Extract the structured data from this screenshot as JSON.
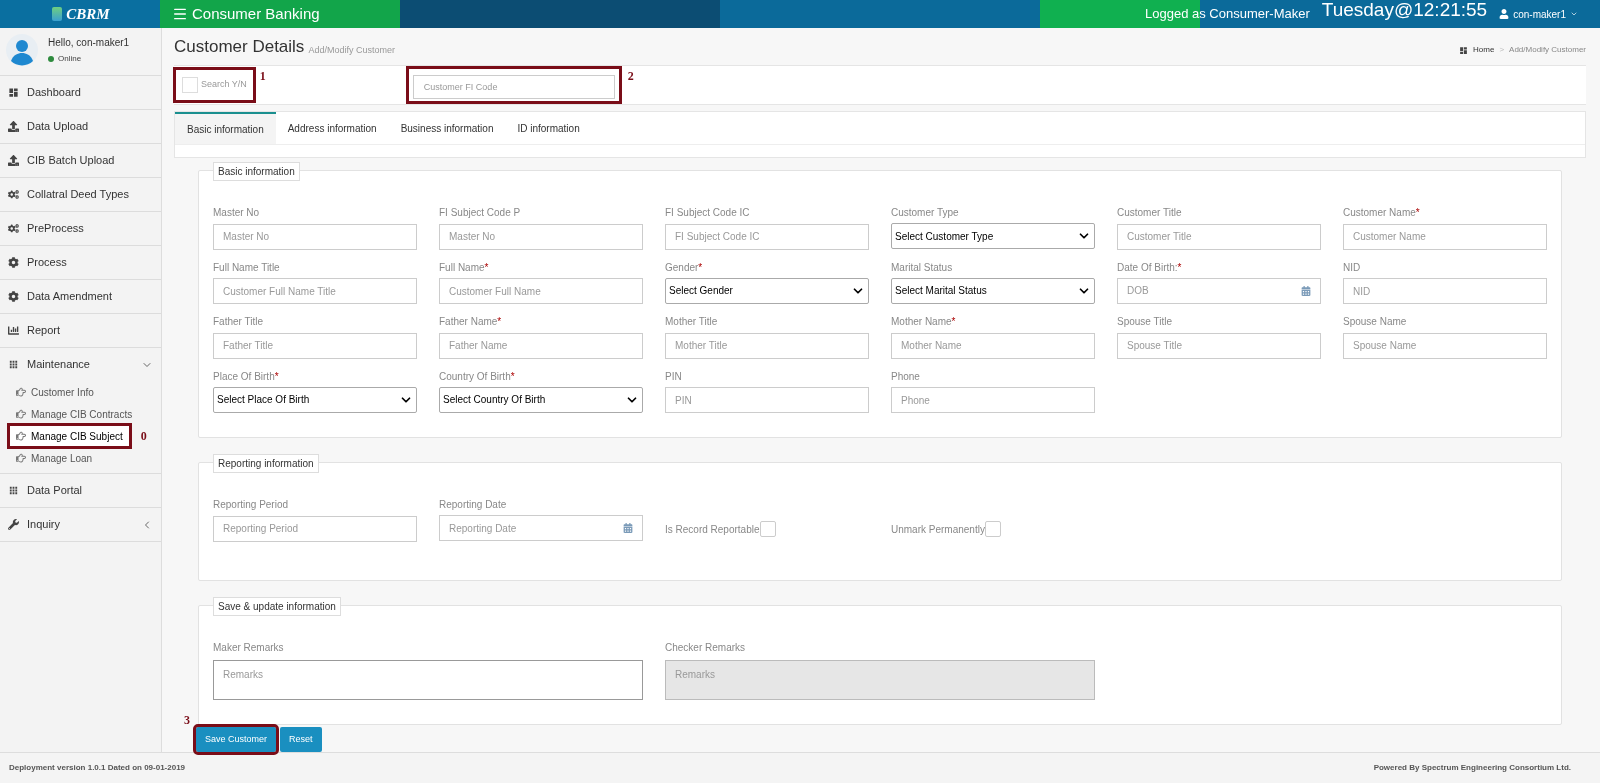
{
  "header": {
    "logo": "CBRM",
    "app_title": "Consumer Banking",
    "logged_as": "Logged as Consumer-Maker",
    "clock": "Tuesday@12:21:55",
    "user": "con-maker1"
  },
  "user_panel": {
    "greeting": "Hello, con-maker1",
    "status": "Online"
  },
  "sidebar": {
    "items": [
      {
        "label": "Dashboard",
        "kind": "dashboard",
        "selected": false
      },
      {
        "label": "Data Upload",
        "kind": "upload",
        "selected": false
      },
      {
        "label": "CIB Batch Upload",
        "kind": "upload",
        "selected": false
      },
      {
        "label": "Collatral Deed Types",
        "kind": "cogs",
        "selected": false
      },
      {
        "label": "PreProcess",
        "kind": "cogs",
        "selected": false
      },
      {
        "label": "Process",
        "kind": "cog",
        "selected": false
      },
      {
        "label": "Data Amendment",
        "kind": "cog",
        "selected": false
      },
      {
        "label": "Report",
        "kind": "chart",
        "selected": false
      },
      {
        "label": "Maintenance",
        "kind": "grid",
        "selected": false,
        "expanded": true,
        "children": [
          {
            "label": "Customer Info",
            "selected": false
          },
          {
            "label": "Manage CIB Contracts",
            "selected": false
          },
          {
            "label": "Manage CIB Subject",
            "selected": true,
            "annotation": "0"
          },
          {
            "label": "Manage Loan",
            "selected": false
          }
        ]
      },
      {
        "label": "Data Portal",
        "kind": "grid",
        "selected": false
      },
      {
        "label": "Inquiry",
        "kind": "wrench",
        "selected": false,
        "expanded": false
      }
    ]
  },
  "page": {
    "title": "Customer Details",
    "subtitle": "Add/Modify Customer",
    "breadcrumb": [
      "Home",
      "Add/Modify Customer"
    ],
    "breadcrumb_separator": ">"
  },
  "search": {
    "checkbox_label": "Search Y/N",
    "checked": false,
    "checkbox_annotation": "1",
    "placeholder": "Customer FI Code",
    "field_annotation": "2"
  },
  "tabs": [
    {
      "label": "Basic information",
      "selected": true
    },
    {
      "label": "Address information",
      "selected": false
    },
    {
      "label": "Business information",
      "selected": false
    },
    {
      "label": "ID information",
      "selected": false
    }
  ],
  "basic_section": {
    "legend": "Basic information",
    "fields": [
      {
        "label": "Master No",
        "kind": "input",
        "placeholder": "Master No"
      },
      {
        "label": "FI Subject Code P",
        "kind": "input",
        "placeholder": "Master No"
      },
      {
        "label": "FI Subject Code IC",
        "kind": "input",
        "placeholder": "FI Subject Code IC"
      },
      {
        "label": "Customer Type",
        "kind": "select",
        "value": "Select Customer Type"
      },
      {
        "label": "Customer Title",
        "kind": "input",
        "placeholder": "Customer Title"
      },
      {
        "label": "Customer Name",
        "required_mark": "*",
        "kind": "input",
        "placeholder": "Customer Name"
      },
      {
        "label": "Full Name Title",
        "kind": "input",
        "placeholder": "Customer Full Name Title"
      },
      {
        "label": "Full Name",
        "required_mark": "*",
        "kind": "input",
        "placeholder": "Customer Full Name"
      },
      {
        "label": "Gender",
        "required_mark": "*",
        "kind": "select",
        "value": "Select Gender"
      },
      {
        "label": "Marital Status",
        "kind": "select",
        "value": "Select Marital Status"
      },
      {
        "label": "Date Of Birth:",
        "required_mark": "*",
        "kind": "date",
        "placeholder": "DOB"
      },
      {
        "label": "NID",
        "kind": "input",
        "placeholder": "NID"
      },
      {
        "label": "Father Title",
        "kind": "input",
        "placeholder": "Father Title"
      },
      {
        "label": "Father Name",
        "required_mark": "*",
        "kind": "input",
        "placeholder": "Father Name"
      },
      {
        "label": "Mother Title",
        "kind": "input",
        "placeholder": "Mother Title"
      },
      {
        "label": "Mother Name",
        "required_mark": "*",
        "kind": "input",
        "placeholder": "Mother Name"
      },
      {
        "label": "Spouse Title",
        "kind": "input",
        "placeholder": "Spouse Title"
      },
      {
        "label": "Spouse Name",
        "kind": "input",
        "placeholder": "Spouse Name"
      },
      {
        "label": "Place Of Birth",
        "required_mark": "*",
        "kind": "select",
        "value": "Select Place Of Birth"
      },
      {
        "label": "Country Of Birth",
        "required_mark": "*",
        "kind": "select",
        "value": "Select Country Of Birth"
      },
      {
        "label": "PIN",
        "kind": "input",
        "placeholder": "PIN"
      },
      {
        "label": "Phone",
        "kind": "input",
        "placeholder": "Phone"
      }
    ]
  },
  "reporting_section": {
    "legend": "Reporting information",
    "fields": [
      {
        "label": "Reporting Period",
        "kind": "input",
        "placeholder": "Reporting Period"
      },
      {
        "label": "Reporting Date",
        "kind": "date",
        "placeholder": "Reporting Date"
      },
      {
        "label": "Is Record Reportable",
        "kind": "checkbox",
        "checked": false
      },
      {
        "label": "Unmark Permanently",
        "kind": "checkbox",
        "checked": false
      }
    ]
  },
  "save_section": {
    "legend": "Save & update information",
    "remarks": [
      {
        "label": "Maker Remarks",
        "placeholder": "Remarks",
        "disabled": false
      },
      {
        "label": "Checker Remarks",
        "placeholder": "Remarks",
        "disabled": true
      }
    ],
    "buttons": [
      {
        "label": "Save Customer",
        "annotation": "3"
      },
      {
        "label": "Reset"
      }
    ]
  },
  "footer": {
    "left": "Deployment version 1.0.1 Dated on 09-01-2019",
    "right": "Powered By Spectrum Engineering Consortium Ltd."
  }
}
